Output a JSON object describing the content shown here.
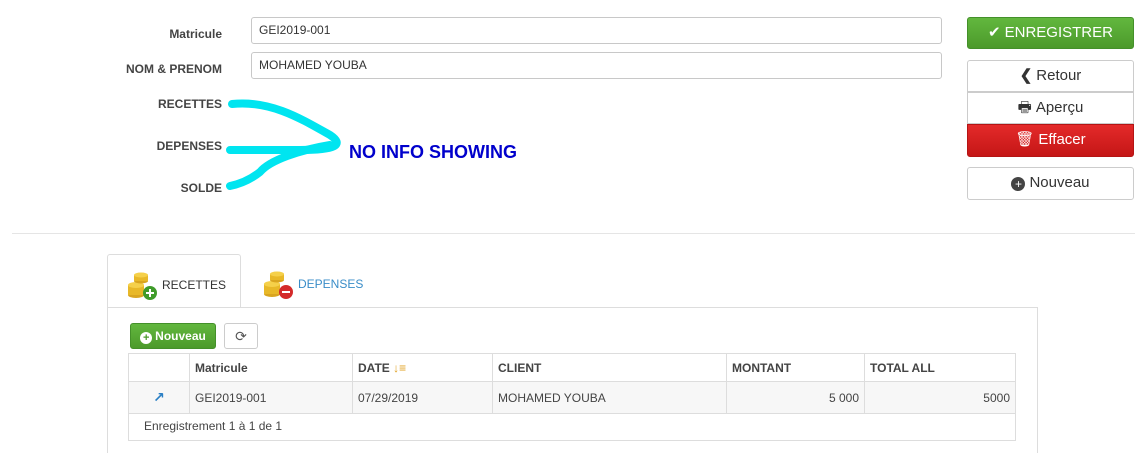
{
  "form": {
    "matricule_label": "Matricule",
    "matricule_value": "GEI2019-001",
    "nom_label": "NOM & PRENOM",
    "nom_value": "MOHAMED YOUBA",
    "recettes_label": "RECETTES",
    "depenses_label": "DEPENSES",
    "solde_label": "SOLDE"
  },
  "annotation": {
    "text": "NO INFO SHOWING",
    "color": "#0000cc",
    "stroke_color": "#00e5f0"
  },
  "actions": {
    "save_label": "ENREGISTRER",
    "back_label": "Retour",
    "preview_label": "Aperçu",
    "delete_label": "Effacer",
    "new_label": "Nouveau"
  },
  "tabs": [
    {
      "label": "RECETTES",
      "icon": "coins-add-icon",
      "active": true
    },
    {
      "label": "DEPENSES",
      "icon": "coins-remove-icon",
      "active": false
    }
  ],
  "toolbar": {
    "new_label": "Nouveau",
    "refresh_icon": "refresh-icon"
  },
  "table": {
    "columns": [
      "",
      "Matricule",
      "DATE",
      "CLIENT",
      "MONTANT",
      "TOTAL ALL"
    ],
    "rows": [
      {
        "matricule": "GEI2019-001",
        "date": "07/29/2019",
        "client": "MOHAMED YOUBA",
        "montant": "5 000",
        "total": "5000"
      }
    ],
    "footer": "Enregistrement 1 à 1 de 1"
  },
  "colors": {
    "green": "#52a332",
    "red": "#d41f1f",
    "link_blue": "#3a8dc8"
  }
}
